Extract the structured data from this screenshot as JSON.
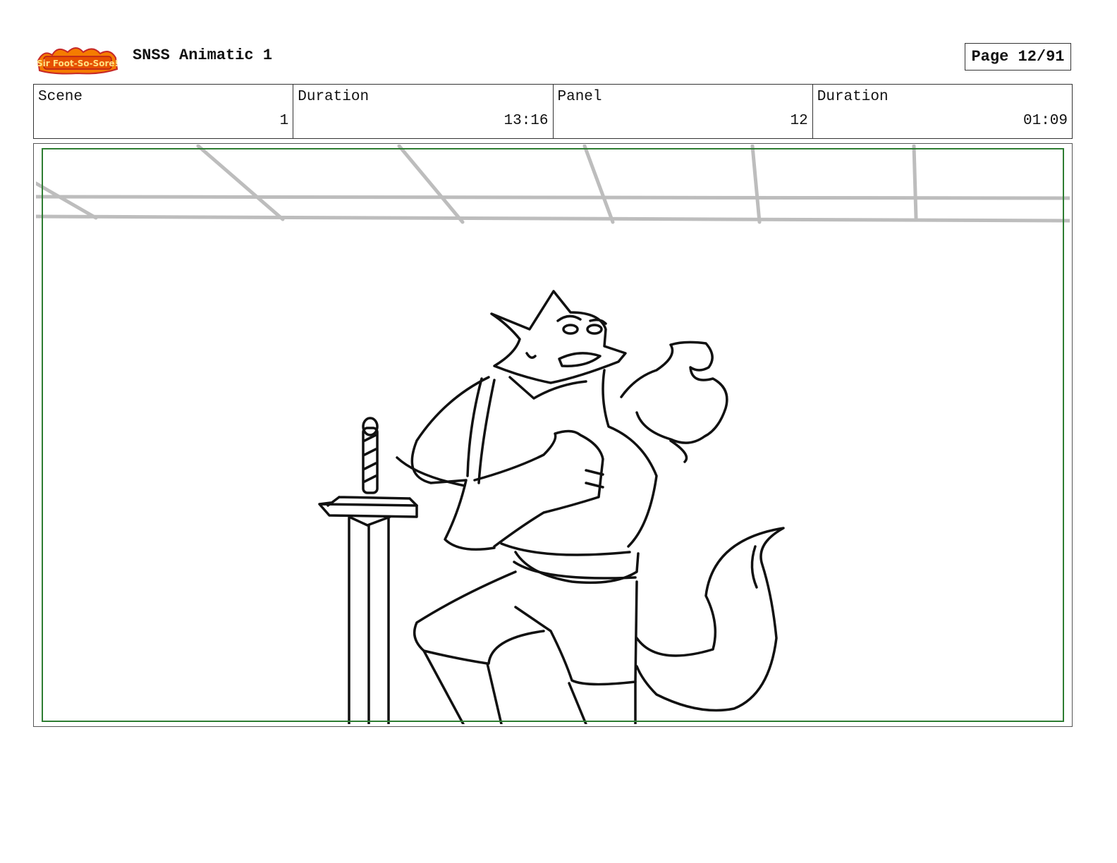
{
  "header": {
    "logo_text": "Sir Foot-So-Sore!",
    "title": "SNSS Animatic 1",
    "page": "Page 12/91"
  },
  "info": {
    "scene_label": "Scene",
    "scene_value": "1",
    "duration_label": "Duration",
    "duration_value": "13:16",
    "panel_label": "Panel",
    "panel_value": "12",
    "panel_duration_label": "Duration",
    "panel_duration_value": "01:09"
  },
  "colors": {
    "safe_frame": "#2e7d32",
    "logo_orange": "#f57c00",
    "logo_red": "#c62828"
  }
}
